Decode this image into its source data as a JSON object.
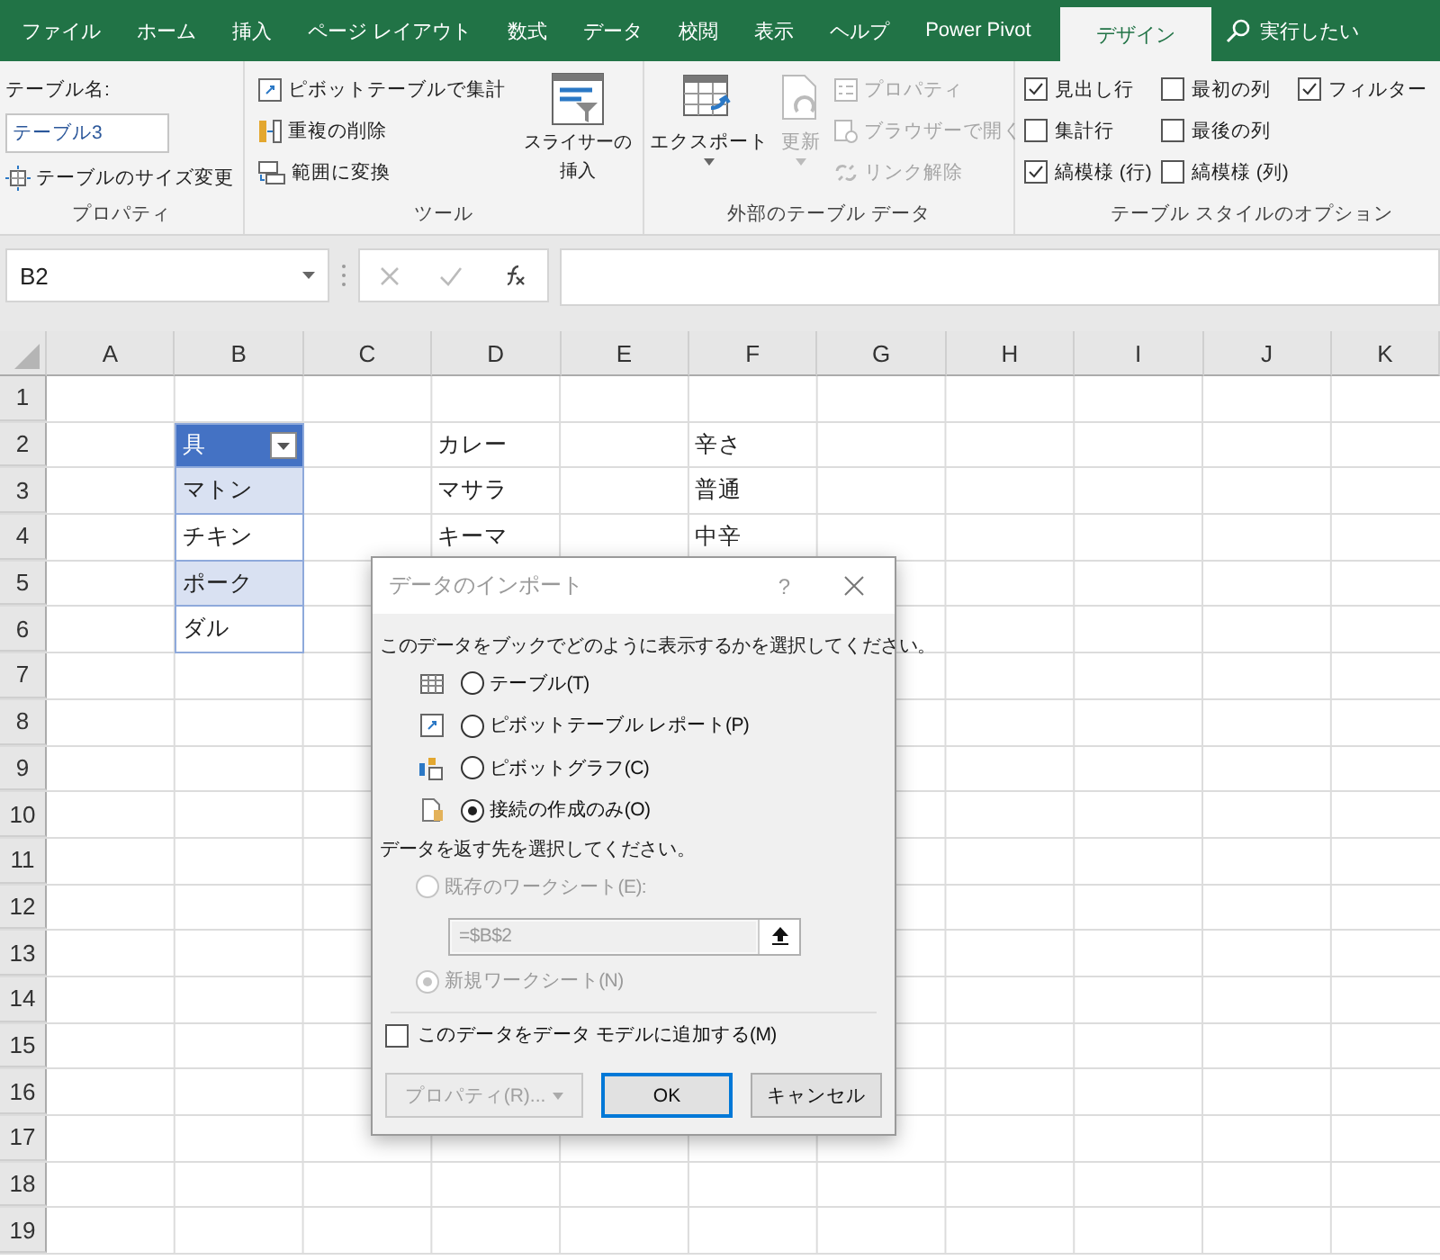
{
  "tabs": [
    {
      "label": "ファイル",
      "selected": false
    },
    {
      "label": "ホーム",
      "selected": false
    },
    {
      "label": "挿入",
      "selected": false
    },
    {
      "label": "ページ レイアウト",
      "selected": false
    },
    {
      "label": "数式",
      "selected": false
    },
    {
      "label": "データ",
      "selected": false
    },
    {
      "label": "校閲",
      "selected": false
    },
    {
      "label": "表示",
      "selected": false
    },
    {
      "label": "ヘルプ",
      "selected": false
    },
    {
      "label": "Power Pivot",
      "selected": false
    },
    {
      "label": "デザイン",
      "selected": true
    }
  ],
  "tell_me": "実行したい",
  "properties_group": {
    "name_label": "テーブル名:",
    "name_value": "テーブル3",
    "resize_button": "テーブルのサイズ変更",
    "label": "プロパティ"
  },
  "tools_group": {
    "items": [
      {
        "kind": "pivot",
        "label": "ピボットテーブルで集計"
      },
      {
        "kind": "dedupe",
        "label": "重複の削除"
      },
      {
        "kind": "convert",
        "label": "範囲に変換"
      }
    ],
    "slicer_lines": [
      "スライサーの",
      "挿入"
    ],
    "label": "ツール"
  },
  "external_group": {
    "export": "エクスポート",
    "refresh": {
      "label": "更新",
      "disabled": true
    },
    "items": [
      {
        "kind": "props",
        "label": "プロパティ",
        "disabled": true
      },
      {
        "kind": "browser",
        "label": "ブラウザーで開く",
        "disabled": true
      },
      {
        "kind": "unlink",
        "label": "リンク解除",
        "disabled": true
      }
    ],
    "label": "外部のテーブル データ"
  },
  "style_options": {
    "columns": [
      [
        {
          "label": "見出し行",
          "checked": true
        },
        {
          "label": "集計行",
          "checked": false
        },
        {
          "label": "縞模様 (行)",
          "checked": true
        }
      ],
      [
        {
          "label": "最初の列",
          "checked": false
        },
        {
          "label": "最後の列",
          "checked": false
        },
        {
          "label": "縞模様 (列)",
          "checked": false
        }
      ],
      [
        {
          "label": "フィルター",
          "checked": true
        }
      ]
    ],
    "label": "テーブル スタイルのオプション"
  },
  "formula_bar": {
    "name_box": "B2"
  },
  "columns": [
    "A",
    "B",
    "C",
    "D",
    "E",
    "F",
    "G",
    "H",
    "I",
    "J",
    "K"
  ],
  "table": {
    "header": "具",
    "rows": [
      "マトン",
      "チキン",
      "ポーク",
      "ダル"
    ]
  },
  "rows": [
    {
      "number": "1"
    },
    {
      "number": "2",
      "d": "カレー",
      "f": "辛さ"
    },
    {
      "number": "3",
      "d": "マサラ",
      "f": "普通"
    },
    {
      "number": "4",
      "d": "キーマ",
      "f": "中辛"
    },
    {
      "number": "5"
    },
    {
      "number": "6"
    },
    {
      "number": "7"
    },
    {
      "number": "8"
    },
    {
      "number": "9"
    },
    {
      "number": "10"
    },
    {
      "number": "11"
    },
    {
      "number": "12"
    },
    {
      "number": "13"
    },
    {
      "number": "14"
    },
    {
      "number": "15"
    },
    {
      "number": "16"
    },
    {
      "number": "17"
    },
    {
      "number": "18"
    },
    {
      "number": "19"
    }
  ],
  "dialog": {
    "title": "データのインポート",
    "help": "?",
    "prompt": "このデータをブックでどのように表示するかを選択してください。",
    "views": [
      {
        "kind": "table",
        "label": "テーブル(T)",
        "selected": false
      },
      {
        "kind": "pivot",
        "label": "ピボットテーブル レポート(P)",
        "selected": false
      },
      {
        "kind": "chart",
        "label": "ピボットグラフ(C)",
        "selected": false
      },
      {
        "kind": "connection",
        "label": "接続の作成のみ(O)",
        "selected": true
      }
    ],
    "dest_prompt": "データを返す先を選択してください。",
    "existing": {
      "label": "既存のワークシート(E):",
      "selected": false,
      "disabled": true
    },
    "range_value": "=$B$2",
    "new_sheet": {
      "label": "新規ワークシート(N)",
      "selected": true,
      "disabled": true
    },
    "model_checkbox": {
      "label": "このデータをデータ モデルに追加する(M)",
      "checked": false
    },
    "buttons": [
      {
        "kind": "menu",
        "label": "プロパティ(R)...",
        "disabled": true
      },
      {
        "kind": "default",
        "label": "OK",
        "disabled": false
      },
      {
        "kind": "plain",
        "label": "キャンセル",
        "disabled": false
      }
    ]
  }
}
